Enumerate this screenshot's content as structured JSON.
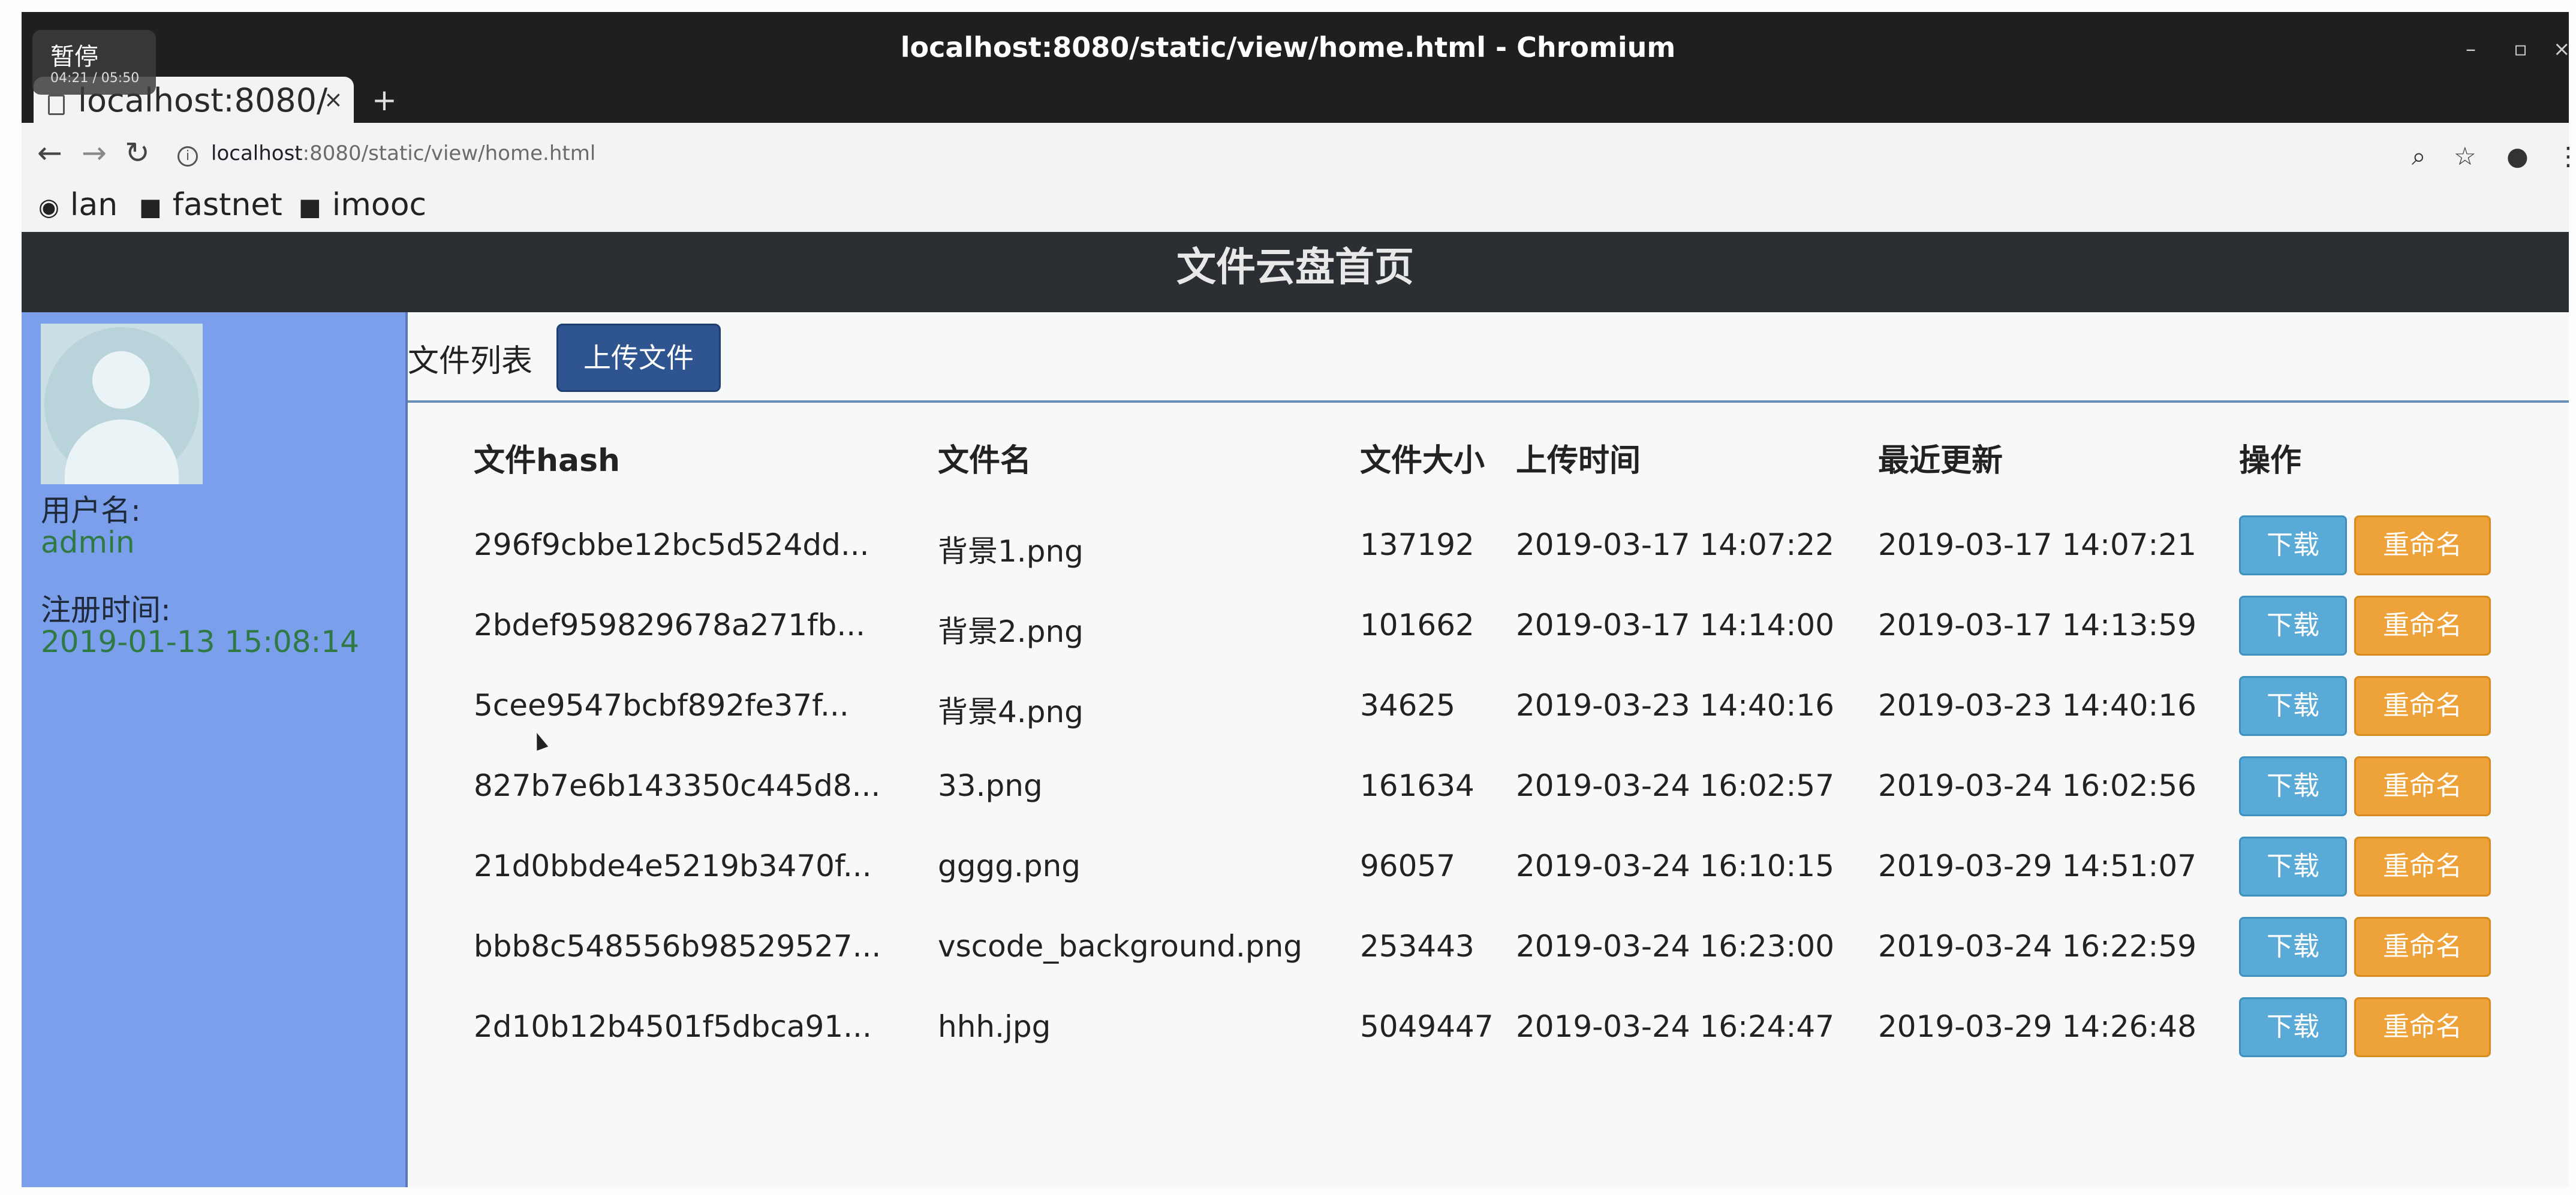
{
  "browser": {
    "window_title": "localhost:8080/static/view/home.html - Chromium",
    "tab_title": "localhost:8080/",
    "tab_close": "×",
    "new_tab": "+",
    "url_host": "localhost",
    "url_rest": ":8080/static/view/home.html",
    "bookmarks": [
      {
        "label": "lan",
        "icon": "github-icon"
      },
      {
        "label": "fastnet",
        "icon": "folder-icon"
      },
      {
        "label": "imooc",
        "icon": "folder-icon"
      }
    ]
  },
  "overlay": {
    "title": "暂停",
    "time": "04:21 / 05:50"
  },
  "page": {
    "title": "文件云盘首页",
    "sidebar": {
      "username_label": "用户名:",
      "username": "admin",
      "register_label": "注册时间:",
      "register_time": "2019-01-13 15:08:14"
    },
    "tab_label": "文件列表",
    "upload_button": "上传文件",
    "columns": [
      "文件hash",
      "文件名",
      "文件大小",
      "上传时间",
      "最近更新",
      "操作"
    ],
    "download_label": "下载",
    "rename_label": "重命名",
    "rows": [
      {
        "hash": "296f9cbbe12bc5d524dd...",
        "name": "背景1.png",
        "size": "137192",
        "upload": "2019-03-17 14:07:22",
        "update": "2019-03-17 14:07:21"
      },
      {
        "hash": "2bdef959829678a271fb...",
        "name": "背景2.png",
        "size": "101662",
        "upload": "2019-03-17 14:14:00",
        "update": "2019-03-17 14:13:59"
      },
      {
        "hash": "5cee9547bcbf892fe37f...",
        "name": "背景4.png",
        "size": "34625",
        "upload": "2019-03-23 14:40:16",
        "update": "2019-03-23 14:40:16"
      },
      {
        "hash": "827b7e6b143350c445d8...",
        "name": "33.png",
        "size": "161634",
        "upload": "2019-03-24 16:02:57",
        "update": "2019-03-24 16:02:56"
      },
      {
        "hash": "21d0bbde4e5219b3470f...",
        "name": "gggg.png",
        "size": "96057",
        "upload": "2019-03-24 16:10:15",
        "update": "2019-03-29 14:51:07"
      },
      {
        "hash": "bbb8c548556b98529527...",
        "name": "vscode_background.png",
        "size": "253443",
        "upload": "2019-03-24 16:23:00",
        "update": "2019-03-24 16:22:59"
      },
      {
        "hash": "2d10b12b4501f5dbca91...",
        "name": "hhh.jpg",
        "size": "5049447",
        "upload": "2019-03-24 16:24:47",
        "update": "2019-03-29 14:26:48"
      }
    ]
  }
}
